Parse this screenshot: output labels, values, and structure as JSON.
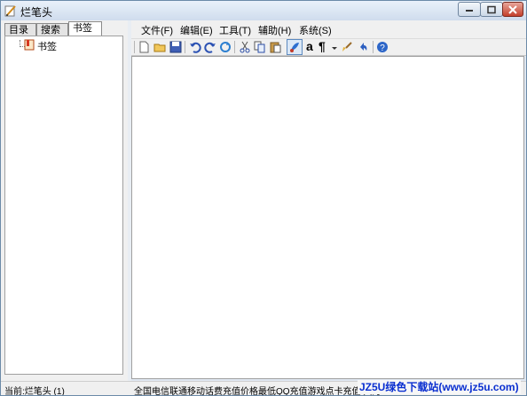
{
  "window": {
    "title": "烂笔头"
  },
  "left_pane": {
    "tabs": [
      {
        "label": "目录",
        "active": false
      },
      {
        "label": "搜索",
        "active": false
      },
      {
        "label": "书签",
        "active": true
      }
    ],
    "tree": {
      "items": [
        {
          "label": "书签",
          "icon": "bookmark-icon"
        }
      ]
    }
  },
  "menu": {
    "items": [
      {
        "label": "文件(F)"
      },
      {
        "label": "编辑(E)"
      },
      {
        "label": "工具(T)"
      },
      {
        "label": "辅助(H)"
      },
      {
        "label": "系统(S)"
      }
    ]
  },
  "toolbar": {
    "buttons": [
      "new-file-icon",
      "open-folder-icon",
      "save-icon",
      "undo-icon",
      "redo-icon",
      "refresh-icon",
      "cut-icon",
      "copy-icon",
      "paste-icon",
      "style-icon",
      "font-icon",
      "paragraph-icon",
      "dropdown-icon",
      "brush-icon",
      "revert-icon",
      "help-icon"
    ],
    "font_glyph": "a",
    "paragraph_glyph": "¶"
  },
  "status": {
    "current": "当前:烂笔头 (1)",
    "ad": "全国电信联通移动话费充值价格最低QQ充值游戏点卡充值 只为",
    "watermark": "JZ5U绿色下载站(www.jz5u.com)"
  },
  "colors": {
    "titlebar": "#cfdced",
    "close": "#c4402c",
    "watermark": "#0a2fd0"
  }
}
